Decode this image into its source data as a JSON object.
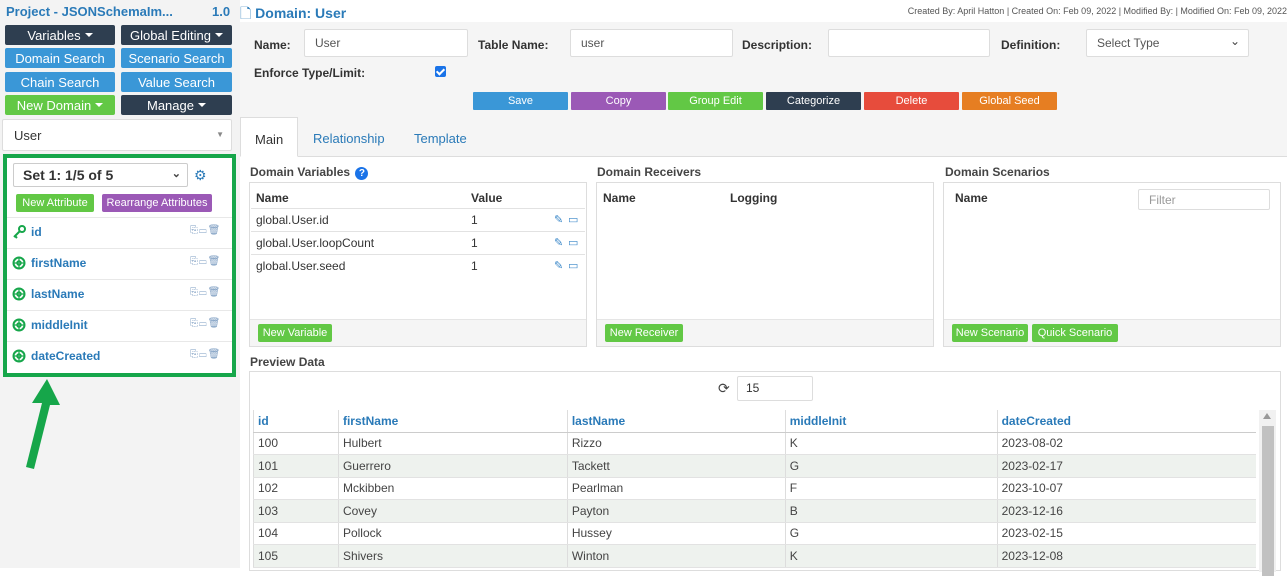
{
  "sidebar": {
    "project_title": "Project - JSONSchemaIm...",
    "project_version": "1.0",
    "buttons": {
      "variables": "Variables",
      "global_editing": "Global Editing",
      "domain_search": "Domain Search",
      "scenario_search": "Scenario Search",
      "chain_search": "Chain Search",
      "value_search": "Value Search",
      "new_domain": "New Domain",
      "manage": "Manage"
    },
    "domain_select": "User",
    "set_select": "Set 1: 1/5 of 5",
    "new_attribute": "New Attribute",
    "rearrange_attributes": "Rearrange Attributes",
    "attributes": [
      {
        "name": "id",
        "icon": "key-icon"
      },
      {
        "name": "firstName",
        "icon": "globe-icon"
      },
      {
        "name": "lastName",
        "icon": "globe-icon"
      },
      {
        "name": "middleInit",
        "icon": "globe-icon"
      },
      {
        "name": "dateCreated",
        "icon": "globe-icon"
      }
    ]
  },
  "header": {
    "domain_title": "Domain: User",
    "meta": "Created By: April Hatton | Created On: Feb 09, 2022 | Modified By: | Modified On: Feb 09, 2022"
  },
  "form": {
    "name_label": "Name:",
    "name_value": "User",
    "table_name_label": "Table Name:",
    "table_name_value": "user",
    "description_label": "Description:",
    "description_value": "",
    "definition_label": "Definition:",
    "definition_value": "Select Type",
    "enforce_label": "Enforce Type/Limit:",
    "enforce_checked": true
  },
  "actions": {
    "save": "Save",
    "copy": "Copy",
    "group_edit": "Group Edit",
    "categorize": "Categorize",
    "delete": "Delete",
    "global_seed": "Global Seed"
  },
  "tabs": [
    "Main",
    "Relationship",
    "Template"
  ],
  "domain_variables": {
    "title": "Domain Variables",
    "col_name": "Name",
    "col_value": "Value",
    "rows": [
      {
        "name": "global.User.id",
        "value": "1"
      },
      {
        "name": "global.User.loopCount",
        "value": "1"
      },
      {
        "name": "global.User.seed",
        "value": "1"
      }
    ],
    "new_button": "New Variable"
  },
  "domain_receivers": {
    "title": "Domain Receivers",
    "col_name": "Name",
    "col_logging": "Logging",
    "new_button": "New Receiver"
  },
  "domain_scenarios": {
    "title": "Domain Scenarios",
    "col_name": "Name",
    "filter_placeholder": "Filter",
    "new_button": "New Scenario",
    "quick_button": "Quick Scenario"
  },
  "preview": {
    "title": "Preview Data",
    "count": "15",
    "columns": [
      "id",
      "firstName",
      "lastName",
      "middleInit",
      "dateCreated"
    ],
    "rows": [
      [
        "100",
        "Hulbert",
        "Rizzo",
        "K",
        "2023-08-02"
      ],
      [
        "101",
        "Guerrero",
        "Tackett",
        "G",
        "2023-02-17"
      ],
      [
        "102",
        "Mckibben",
        "Pearlman",
        "F",
        "2023-10-07"
      ],
      [
        "103",
        "Covey",
        "Payton",
        "B",
        "2023-12-16"
      ],
      [
        "104",
        "Pollock",
        "Hussey",
        "G",
        "2023-02-15"
      ],
      [
        "105",
        "Shivers",
        "Winton",
        "K",
        "2023-12-08"
      ]
    ]
  },
  "colors": {
    "accent": "#2a7ab8",
    "highlight_border": "#16a64a",
    "annotation_arrow": "#16a64a"
  }
}
